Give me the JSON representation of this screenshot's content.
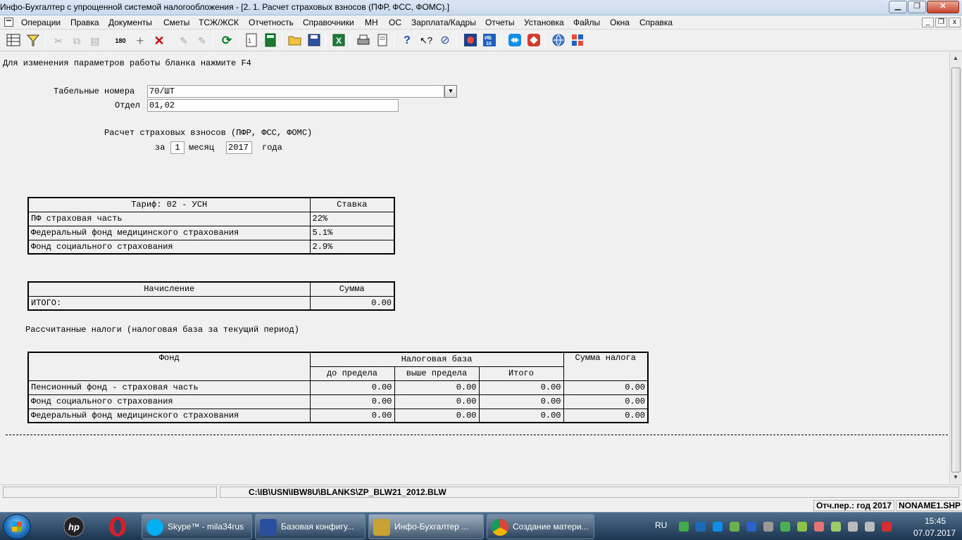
{
  "window": {
    "title": "Инфо-Бухгалтер с упрощенной системой налогообложения - [2. 1. Расчет страховых взносов (ПФР, ФСС, ФОМС).]",
    "min_label": "▁",
    "max_label": "❐",
    "close_label": "✕"
  },
  "menu": {
    "items": [
      "Операции",
      "Правка",
      "Документы",
      "Сметы",
      "ТСЖ/ЖСК",
      "Отчетность",
      "Справочники",
      "МН",
      "ОС",
      "Зарплата/Кадры",
      "Отчеты",
      "Установка",
      "Файлы",
      "Окна",
      "Справка"
    ],
    "mdi_min": "_",
    "mdi_restore": "❐",
    "mdi_close": "x"
  },
  "toolbar": {
    "icons": [
      "grid-icon",
      "filter-icon",
      "cut-icon",
      "copy-icon",
      "paste-icon",
      "numbering-icon",
      "add-icon",
      "delete-icon",
      "refresh-icon",
      "form-icon",
      "calculator-icon",
      "open-folder-icon",
      "save-icon",
      "excel-icon",
      "print-icon",
      "preview-icon",
      "help-icon",
      "context-help-icon",
      "navigator-icon",
      "ib-logo-icon",
      "ib10-icon",
      "teamviewer-icon",
      "anydesk-icon",
      "web-icon",
      "update-icon"
    ]
  },
  "doc": {
    "hint": "Для изменения параметров работы бланка нажмите F4",
    "tabnum_label": "Табельные номера",
    "tabnum_value": "70/ШТ",
    "dept_label": "Отдел",
    "dept_value": "01,02",
    "calc_title": "Расчет страховых взносов (ПФР, ФСС, ФОМС)",
    "period_prefix": "за",
    "month_value": "1",
    "month_label": "месяц",
    "year_value": "2017",
    "year_label": "года"
  },
  "tariff_table": {
    "header_tariff": "Тариф: 02 - УСН",
    "header_rate": "Ставка",
    "rows": [
      {
        "name": "ПФ страховая часть",
        "rate": "22%"
      },
      {
        "name": "Федеральный фонд медицинского страхования",
        "rate": "5.1%"
      },
      {
        "name": "Фонд социального страхования",
        "rate": "2.9%"
      }
    ]
  },
  "accrual_table": {
    "header_accrual": "Начисление",
    "header_sum": "Сумма",
    "total_label": "ИТОГО:",
    "total_value": "0.00"
  },
  "taxes": {
    "title": "Рассчитанные налоги (налоговая база за текущий период)",
    "header_fund": "Фонд",
    "header_base": "Налоговая база",
    "header_tax": "Сумма налога",
    "sub_below": "до предела",
    "sub_above": "выше предела",
    "sub_total": "Итого",
    "rows": [
      {
        "fund": "Пенсионный фонд - страховая часть",
        "below": "0.00",
        "above": "0.00",
        "total": "0.00",
        "tax": "0.00"
      },
      {
        "fund": "Фонд социального страхования",
        "below": "0.00",
        "above": "0.00",
        "total": "0.00",
        "tax": "0.00"
      },
      {
        "fund": "Федеральный фонд медицинского страхования",
        "below": "0.00",
        "above": "0.00",
        "total": "0.00",
        "tax": "0.00"
      }
    ]
  },
  "pathbar": {
    "path": "C:\\IB\\USN\\IBW8U\\BLANKS\\ZP_BLW21_2012.BLW"
  },
  "statusbar": {
    "period": "Отч.пер.: год 2017",
    "file": "NONAME1.SHP"
  },
  "taskbar": {
    "tasks": [
      {
        "label": "Skype™ - mila34rus",
        "color": "#00aff0"
      },
      {
        "label": "Базовая конфигу...",
        "color": "#2a4f9e"
      },
      {
        "label": "Инфо-Бухгалтер ...",
        "color": "#c9a233"
      },
      {
        "label": "Создание матери...",
        "color": "#db4437"
      }
    ],
    "language": "RU",
    "time": "15:45",
    "date": "07.07.2017"
  }
}
